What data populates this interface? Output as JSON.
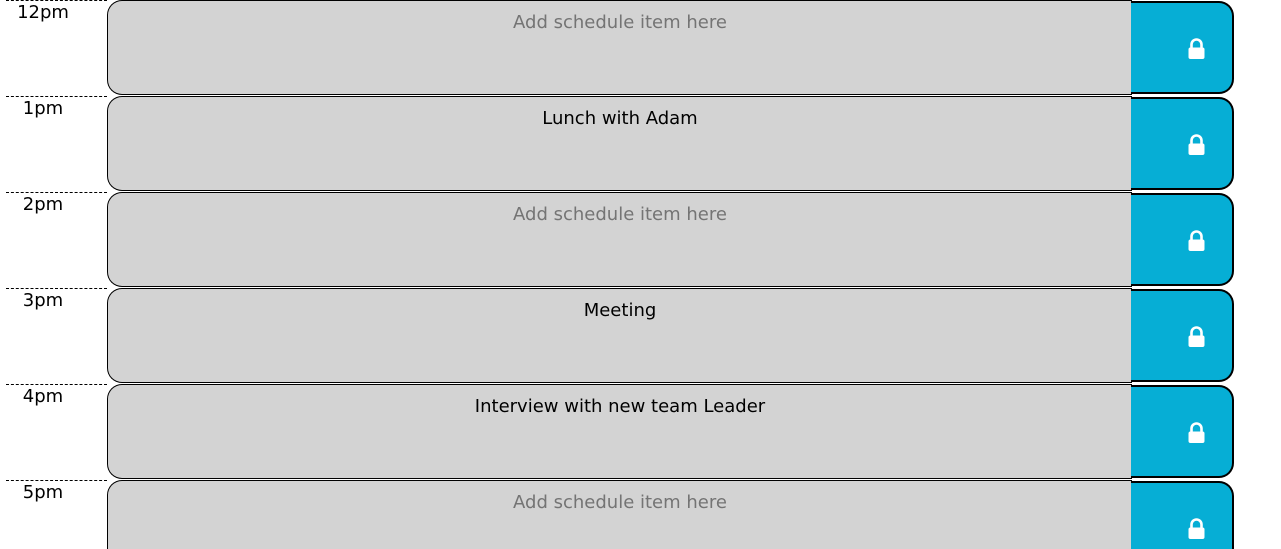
{
  "colors": {
    "entry_background": "#d3d3d3",
    "save_button": "#06aed5",
    "placeholder": "#747474"
  },
  "rows": [
    {
      "hour": "12pm",
      "text": "",
      "placeholder": "Add schedule item here",
      "save_icon": "lock-icon"
    },
    {
      "hour": "1pm",
      "text": "Lunch with Adam",
      "placeholder": "Add schedule item here",
      "save_icon": "lock-icon"
    },
    {
      "hour": "2pm",
      "text": "",
      "placeholder": "Add schedule item here",
      "save_icon": "lock-icon"
    },
    {
      "hour": "3pm",
      "text": "Meeting",
      "placeholder": "Add schedule item here",
      "save_icon": "lock-icon"
    },
    {
      "hour": "4pm",
      "text": "Interview with new team Leader",
      "placeholder": "Add schedule item here",
      "save_icon": "lock-icon"
    },
    {
      "hour": "5pm",
      "text": "",
      "placeholder": "Add schedule item here",
      "save_icon": "lock-icon"
    }
  ]
}
